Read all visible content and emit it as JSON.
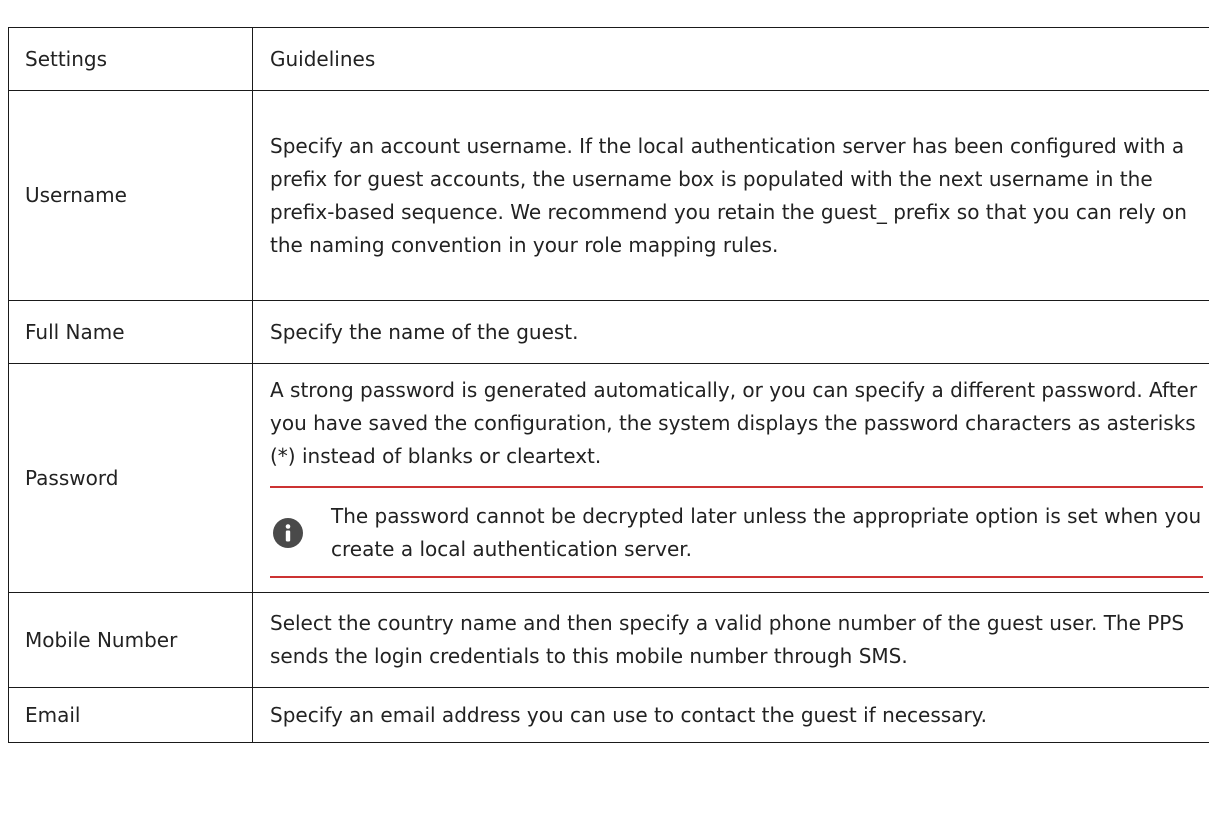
{
  "table": {
    "headers": [
      "Settings",
      "Guidelines"
    ],
    "rows": [
      {
        "setting": "Username",
        "guideline": "Specify an account username. If the local authentication server has been configured with a prefix for guest accounts, the username box is populated with the next username in the prefix-based sequence. We recommend you retain the guest_ prefix so that you can rely on the naming convention in your role mapping rules."
      },
      {
        "setting": "Full Name",
        "guideline": "Specify the name of the guest."
      },
      {
        "setting": "Password",
        "guideline": "A strong password is generated automatically, or you can specify a different password. After you have saved the configuration, the system displays the password characters as asterisks (*) instead of blanks or cleartext.",
        "note": {
          "icon": "info-icon",
          "text": "The password cannot be decrypted later unless the appropriate option is set when you create a local authentication server."
        }
      },
      {
        "setting": "Mobile Number",
        "guideline": "Select the country name and then specify a valid phone number of the guest user. The PPS sends the login credentials to this mobile number through SMS."
      },
      {
        "setting": "Email",
        "guideline": "Specify an email address you can use to contact the guest if necessary."
      }
    ]
  },
  "colors": {
    "border": "#1a1a1a",
    "note_rule": "#cc3333",
    "icon_bg": "#4a4a4a",
    "text": "#222222"
  }
}
